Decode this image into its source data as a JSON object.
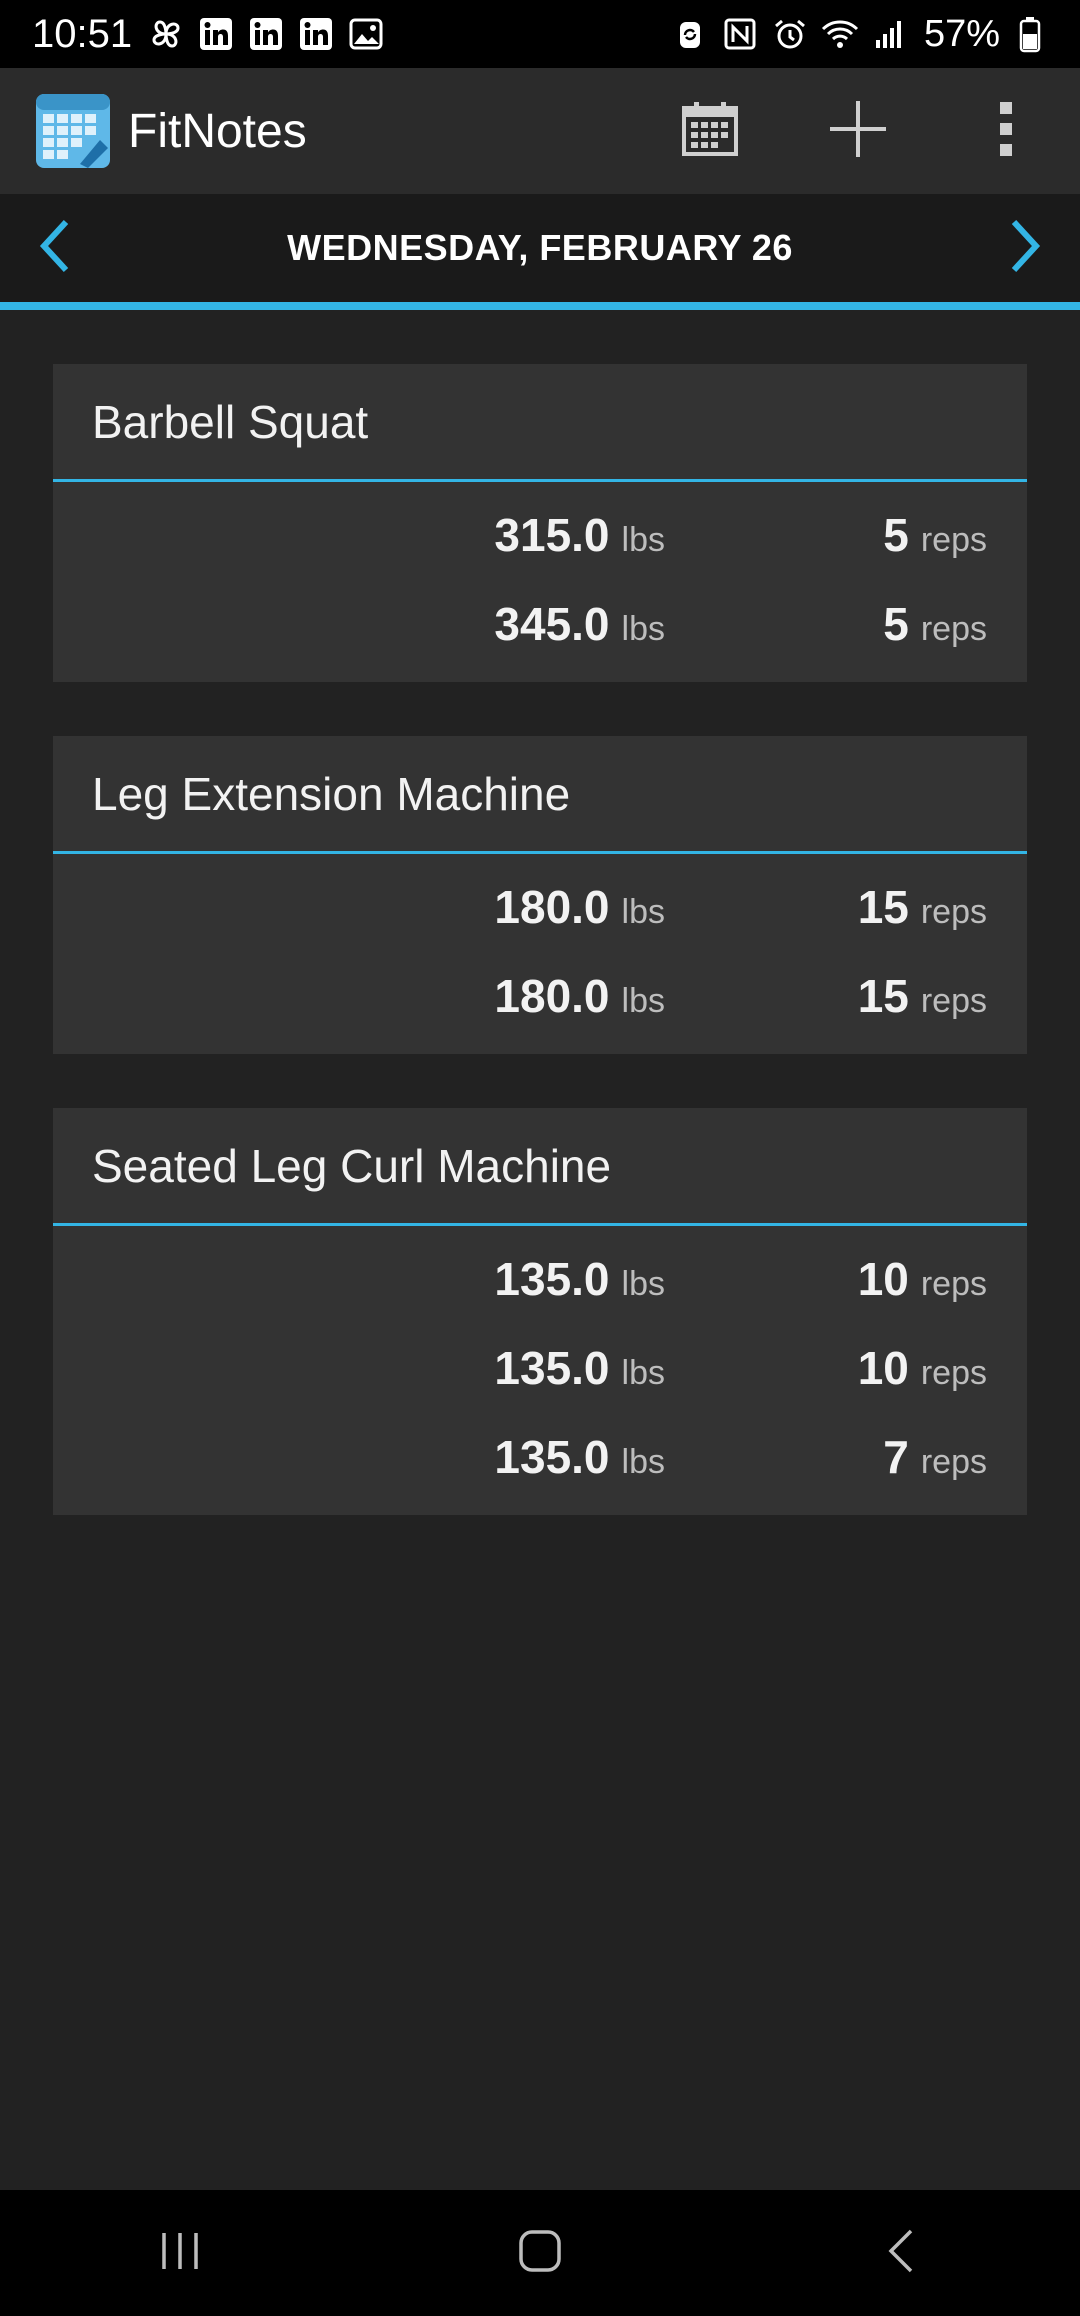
{
  "status_bar": {
    "time": "10:51",
    "battery": "57%",
    "left_icons": [
      "pinwheel-icon",
      "linkedin-icon",
      "linkedin-icon",
      "linkedin-icon",
      "image-icon"
    ],
    "right_icons": [
      "sync-icon",
      "nfc-icon",
      "alarm-icon",
      "wifi-icon",
      "signal-icon",
      "battery-icon"
    ]
  },
  "app_bar": {
    "title": "FitNotes",
    "actions": [
      "calendar-icon",
      "add-icon",
      "overflow-menu-icon"
    ]
  },
  "date_nav": {
    "date": "WEDNESDAY, FEBRUARY 26"
  },
  "colors": {
    "accent": "#33b5e5",
    "background": "#222222",
    "card": "#333333"
  },
  "workouts": [
    {
      "name": "Barbell Squat",
      "sets": [
        {
          "weight": "315.0",
          "weight_unit": "lbs",
          "reps": "5",
          "reps_unit": "reps"
        },
        {
          "weight": "345.0",
          "weight_unit": "lbs",
          "reps": "5",
          "reps_unit": "reps"
        }
      ]
    },
    {
      "name": "Leg Extension Machine",
      "sets": [
        {
          "weight": "180.0",
          "weight_unit": "lbs",
          "reps": "15",
          "reps_unit": "reps"
        },
        {
          "weight": "180.0",
          "weight_unit": "lbs",
          "reps": "15",
          "reps_unit": "reps"
        }
      ]
    },
    {
      "name": "Seated Leg Curl Machine",
      "sets": [
        {
          "weight": "135.0",
          "weight_unit": "lbs",
          "reps": "10",
          "reps_unit": "reps"
        },
        {
          "weight": "135.0",
          "weight_unit": "lbs",
          "reps": "10",
          "reps_unit": "reps"
        },
        {
          "weight": "135.0",
          "weight_unit": "lbs",
          "reps": "7",
          "reps_unit": "reps"
        }
      ]
    }
  ],
  "nav_bar": [
    "recent-apps-icon",
    "home-icon",
    "back-icon"
  ]
}
